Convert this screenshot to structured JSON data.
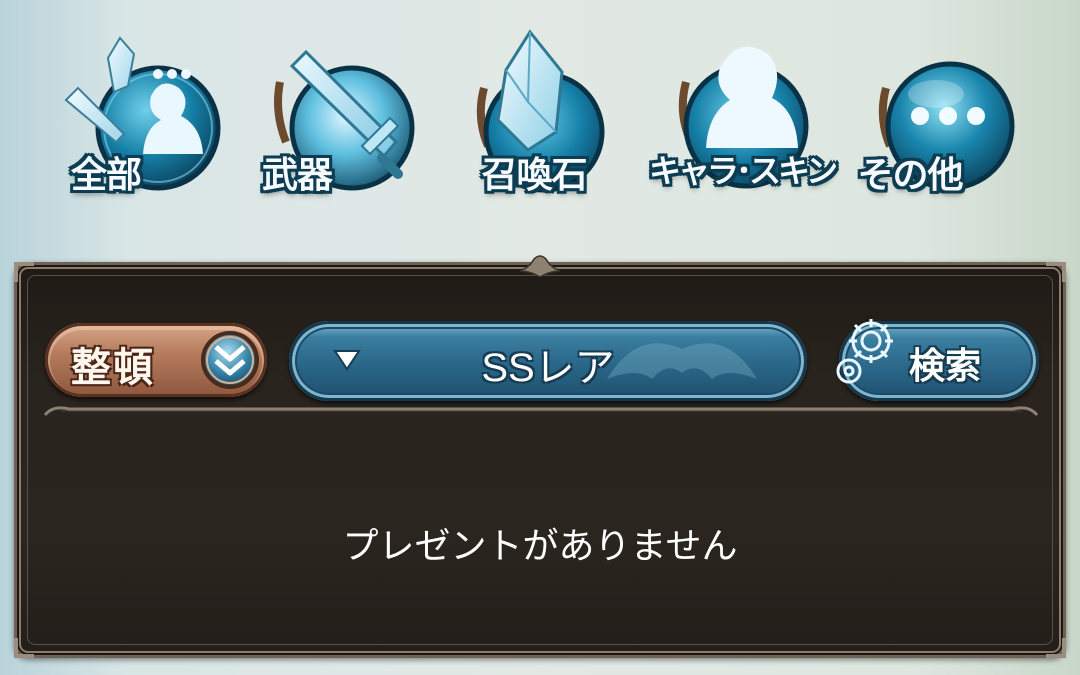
{
  "categories": [
    {
      "label": "全部",
      "icon": "all-items-icon"
    },
    {
      "label": "武器",
      "icon": "sword-icon"
    },
    {
      "label": "召喚石",
      "icon": "summon-crystal-icon"
    },
    {
      "label": "キャラ･スキン",
      "icon": "character-icon"
    },
    {
      "label": "その他",
      "icon": "ellipsis-icon"
    }
  ],
  "toolbar": {
    "sort_label": "整頓",
    "sort_icon": "double-chevron-down-icon",
    "rarity_value": "SSレア",
    "rarity_icon": "triangle-down-icon",
    "search_label": "検索",
    "search_icon": "gear-icon"
  },
  "empty_message": "プレゼントがありません",
  "colors": {
    "accent_blue": "#2a6688",
    "panel_bg": "#2a241e",
    "sort_button": "#b67c5e"
  }
}
